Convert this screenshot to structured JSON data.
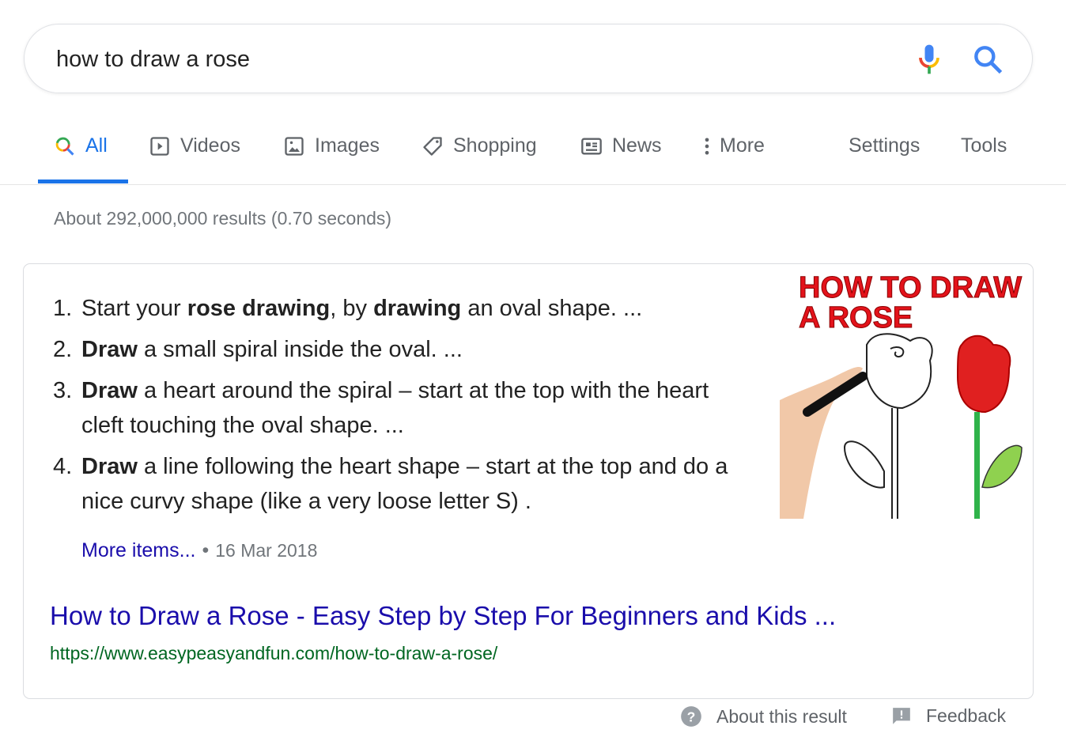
{
  "search": {
    "query": "how to draw a rose",
    "mic_icon": "microphone-icon",
    "search_icon": "search-icon"
  },
  "tabs": [
    {
      "label": "All",
      "icon": "search-icon"
    },
    {
      "label": "Videos",
      "icon": "play-icon"
    },
    {
      "label": "Images",
      "icon": "image-icon"
    },
    {
      "label": "Shopping",
      "icon": "tag-icon"
    },
    {
      "label": "News",
      "icon": "newspaper-icon"
    },
    {
      "label": "More",
      "icon": "more-vert-icon"
    }
  ],
  "tools": {
    "settings": "Settings",
    "tools": "Tools"
  },
  "stats": "About 292,000,000 results (0.70 seconds)",
  "snippet": {
    "items": [
      {
        "num": "1.",
        "segments": [
          {
            "t": "Start your "
          },
          {
            "t": "rose drawing",
            "b": true
          },
          {
            "t": ", by "
          },
          {
            "t": "drawing",
            "b": true
          },
          {
            "t": " an oval shape. ..."
          }
        ]
      },
      {
        "num": "2.",
        "segments": [
          {
            "t": "Draw",
            "b": true
          },
          {
            "t": " a small spiral inside the oval. ..."
          }
        ]
      },
      {
        "num": "3.",
        "segments": [
          {
            "t": "Draw",
            "b": true
          },
          {
            "t": " a heart around the spiral – start at the top with the heart cleft touching the oval shape. ..."
          }
        ]
      },
      {
        "num": "4.",
        "segments": [
          {
            "t": "Draw",
            "b": true
          },
          {
            "t": " a line following the heart shape – start at the top and do a nice curvy shape (like a very loose letter S) ."
          }
        ]
      }
    ],
    "image_text": [
      "HOW TO DRAW",
      "A ROSE"
    ],
    "more_items": "More items...",
    "separator": "•",
    "date": "16 Mar 2018",
    "title": "How to Draw a Rose - Easy Step by Step For Beginners and Kids ...",
    "url": "https://www.easypeasyandfun.com/how-to-draw-a-rose/"
  },
  "footer": {
    "about": "About this result",
    "feedback": "Feedback"
  },
  "colors": {
    "accent": "#1a73e8",
    "link": "#1a0dab",
    "url": "#006621"
  }
}
